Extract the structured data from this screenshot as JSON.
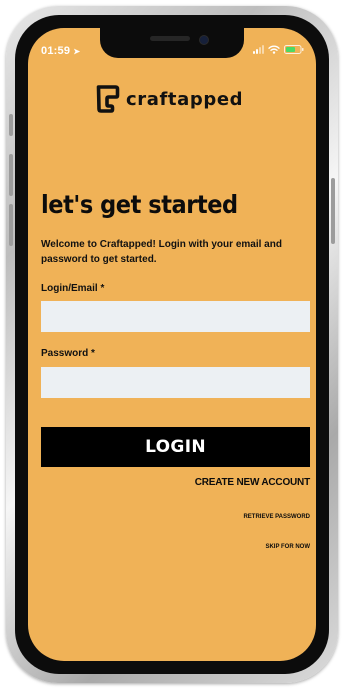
{
  "status_bar": {
    "time": "01:59",
    "location_glyph": "➤",
    "icons": [
      "signal-icon",
      "wifi-icon",
      "battery-icon"
    ]
  },
  "brand": {
    "name": "craftapped",
    "logo_icon": "craftapped-logo-icon"
  },
  "headline": "let's get started",
  "intro_text": "Welcome to Craftapped! Login with your email and password to get started.",
  "form": {
    "login_label": "Login/Email *",
    "login_value": "",
    "password_label": "Password *",
    "password_value": ""
  },
  "buttons": {
    "login": "LOGIN"
  },
  "links": {
    "create_account": "CREATE NEW ACCOUNT",
    "retrieve_password": "RETRIEVE PASSWORD",
    "skip": "SKIP FOR NOW"
  },
  "colors": {
    "background": "#f0b257",
    "text": "#111111",
    "button": "#000000",
    "button_text": "#ffffff",
    "input": "#ecf0f3",
    "battery": "#4cd964"
  }
}
